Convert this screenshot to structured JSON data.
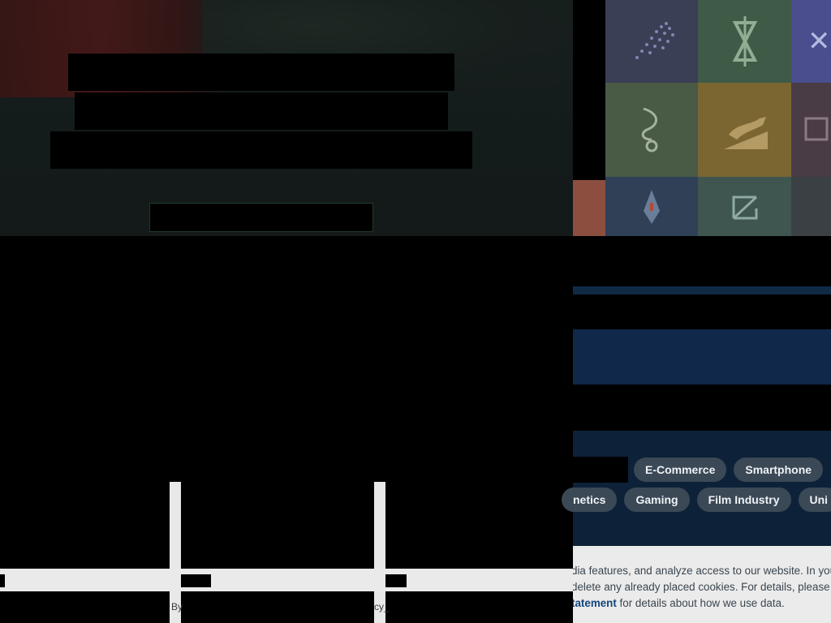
{
  "colors": {
    "hero_overlay": "#141a19",
    "tile_palette": [
      "#3a3f55",
      "#3f5a47",
      "#4a4d8e",
      "#495a45",
      "#7b6632",
      "#4a3c44",
      "#8c4f3f",
      "#2f4057",
      "#3e5550"
    ],
    "chip_bg": "#3b4856",
    "cookie_bg": "#ebebeb",
    "cookie_link": "#12457a",
    "band_blue": "#10294a"
  },
  "tiles": {
    "icons": [
      "dots-icon",
      "hourglass-icon",
      "close-icon",
      "hook-icon",
      "leopard-icon",
      "frame-icon",
      "figure-icon",
      "box-icon"
    ],
    "close_glyph": "✕"
  },
  "chips": {
    "row1": [
      "E-Commerce",
      "Smartphone"
    ],
    "row2_partial": "netics",
    "row2": [
      "Gaming",
      "Film Industry"
    ],
    "row2_trailing": "Uni"
  },
  "footer": {
    "fragment_left": "By",
    "fragment_right": "cy_"
  },
  "cookie": {
    "line1": "dia features, and analyze access to our website. In your",
    "line2": "delete any already placed cookies. For details, please se",
    "line3_link": "tatement",
    "line3_rest": " for details about how we use data."
  }
}
